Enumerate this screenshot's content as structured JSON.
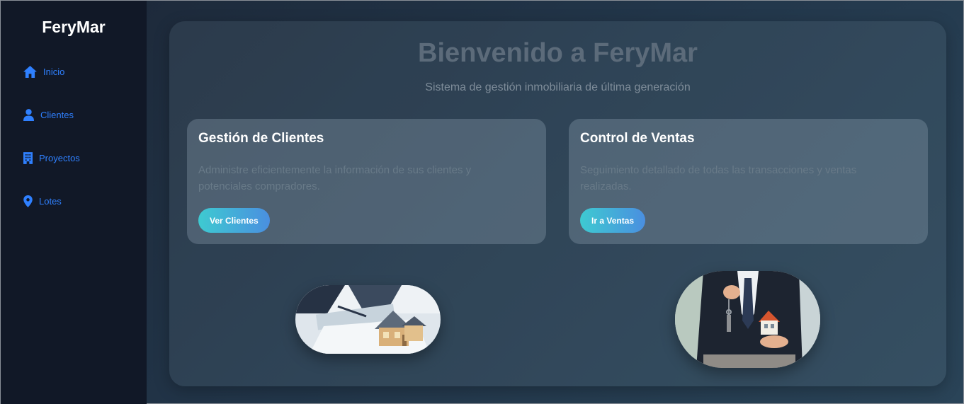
{
  "sidebar": {
    "brand": "FeryMar",
    "items": [
      {
        "label": "Inicio",
        "icon": "home-icon"
      },
      {
        "label": "Clientes",
        "icon": "user-icon"
      },
      {
        "label": "Proyectos",
        "icon": "building-icon"
      },
      {
        "label": "Lotes",
        "icon": "map-pin-icon"
      }
    ]
  },
  "main": {
    "title": "Bienvenido a FeryMar",
    "subtitle": "Sistema de gestión inmobiliaria de última generación",
    "cards": [
      {
        "title": "Gestión de Clientes",
        "description": "Administre eficientemente la información de sus clientes y potenciales compradores.",
        "button": "Ver Clientes"
      },
      {
        "title": "Control de Ventas",
        "description": "Seguimiento detallado de todas las transacciones y ventas realizadas.",
        "button": "Ir a Ventas"
      }
    ]
  },
  "colors": {
    "sidebar_bg": "#111827",
    "nav_accent": "#2f80ff",
    "button_gradient_start": "#3ecad1",
    "button_gradient_end": "#4a8fe0"
  }
}
